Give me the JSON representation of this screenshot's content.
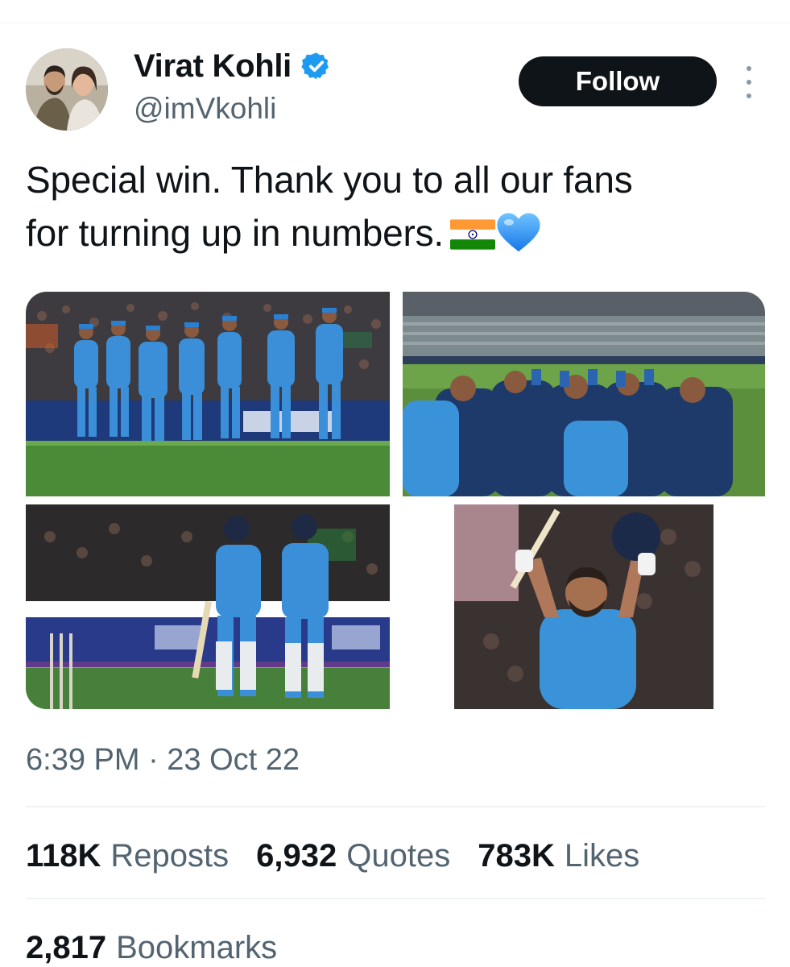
{
  "author": {
    "display_name": "Virat Kohli",
    "handle": "@imVkohli",
    "verified_icon": "verified-badge-icon",
    "verified_color": "#1d9bf0"
  },
  "follow_button": {
    "label": "Follow"
  },
  "more_menu": {
    "icon": "more-vertical-icon"
  },
  "tweet": {
    "text_line1": "Special win. Thank you to all our fans",
    "text_line2": "for turning up in numbers.",
    "emoji": [
      "india-flag",
      "blue-heart"
    ]
  },
  "media": {
    "count": 4,
    "items": [
      {
        "name": "team-celebration-photo"
      },
      {
        "name": "team-huddle-photo"
      },
      {
        "name": "batters-walking-photo"
      },
      {
        "name": "kohli-celebration-photo"
      }
    ]
  },
  "timestamp": "6:39 PM · 23 Oct 22",
  "stats": {
    "reposts_count": "118K",
    "reposts_label": "Reposts",
    "quotes_count": "6,932",
    "quotes_label": "Quotes",
    "likes_count": "783K",
    "likes_label": "Likes",
    "bookmarks_count": "2,817",
    "bookmarks_label": "Bookmarks"
  },
  "colors": {
    "text_primary": "#0f1419",
    "text_secondary": "#536471",
    "divider": "#eff3f4",
    "accent": "#1d9bf0"
  }
}
